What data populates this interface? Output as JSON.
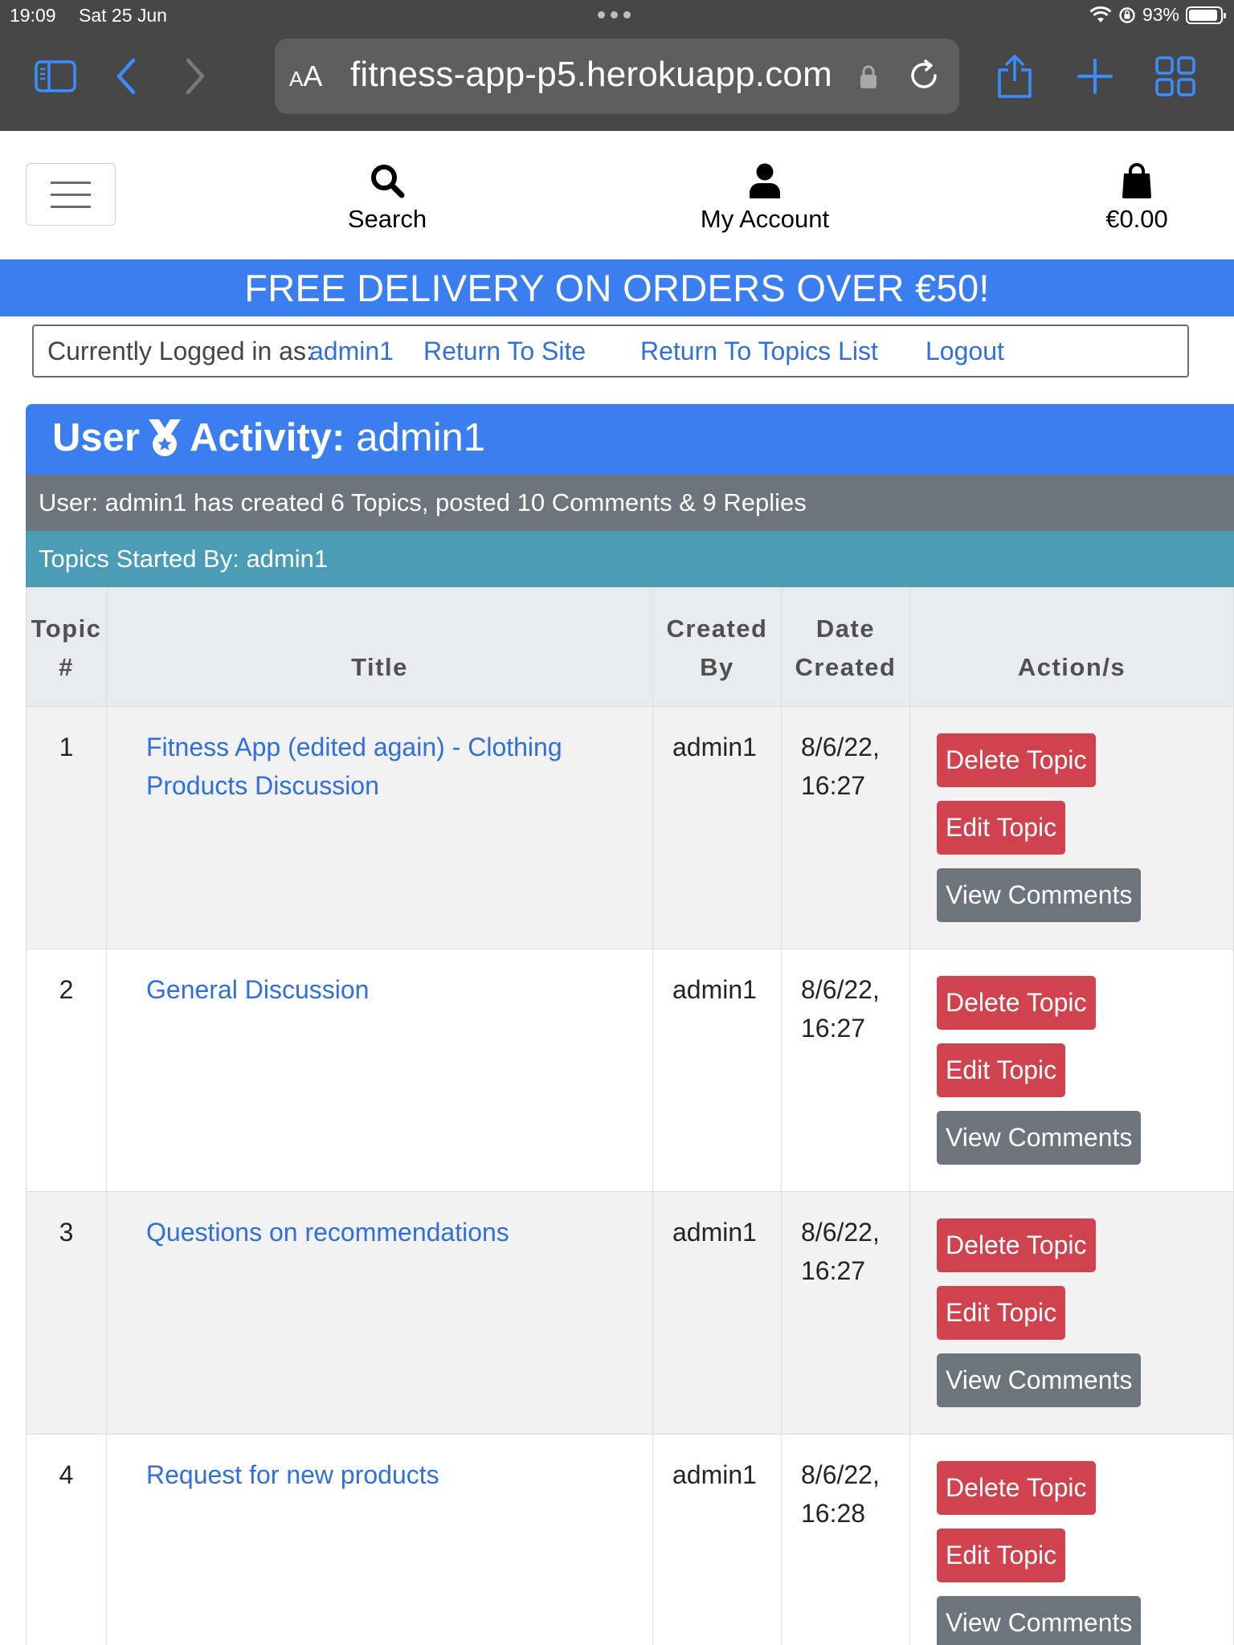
{
  "status_bar": {
    "time": "19:09",
    "date": "Sat 25 Jun",
    "battery": "93%",
    "battery_level": 0.93
  },
  "browser": {
    "url": "fitness-app-p5.herokuapp.com",
    "aa_label_small": "A",
    "aa_label_large": "A"
  },
  "header": {
    "search_label": "Search",
    "account_label": "My Account",
    "bag_total": "€0.00"
  },
  "banner": {
    "text": "FREE DELIVERY ON ORDERS OVER €50!"
  },
  "login_bar": {
    "prefix": "Currently Logged in as:",
    "username": "admin1",
    "return_site": "Return To Site",
    "return_topics": "Return To Topics List",
    "logout": "Logout"
  },
  "activity": {
    "title_prefix": "User",
    "title_mid": "Activity:",
    "title_user": "admin1",
    "summary": "User: admin1 has created 6 Topics, posted 10 Comments & 9 Replies",
    "topics_heading": "Topics Started By: admin1"
  },
  "table": {
    "headers": {
      "num_line1": "Topic",
      "num_line2": "#",
      "title": "Title",
      "by_line1": "Created",
      "by_line2": "By",
      "date_line1": "Date",
      "date_line2": "Created",
      "actions": "Action/s"
    },
    "rows": [
      {
        "num": "1",
        "title": "Fitness App (edited again) - Clothing Products Discussion",
        "created_by": "admin1",
        "date_line1": "8/6/22,",
        "date_line2": "16:27"
      },
      {
        "num": "2",
        "title": "General Discussion",
        "created_by": "admin1",
        "date_line1": "8/6/22,",
        "date_line2": "16:27"
      },
      {
        "num": "3",
        "title": "Questions on recommendations",
        "created_by": "admin1",
        "date_line1": "8/6/22,",
        "date_line2": "16:27"
      },
      {
        "num": "4",
        "title": "Request for new products",
        "created_by": "admin1",
        "date_line1": "8/6/22,",
        "date_line2": "16:28"
      }
    ],
    "actions": {
      "delete": "Delete Topic",
      "edit": "Edit Topic",
      "view": "View Comments"
    }
  },
  "colors": {
    "primary": "#3a7ef0",
    "danger": "#d0424d",
    "secondary": "#6d747c",
    "info": "#4a9db5",
    "link": "#2f6fe0",
    "browser_chrome": "#474747"
  }
}
